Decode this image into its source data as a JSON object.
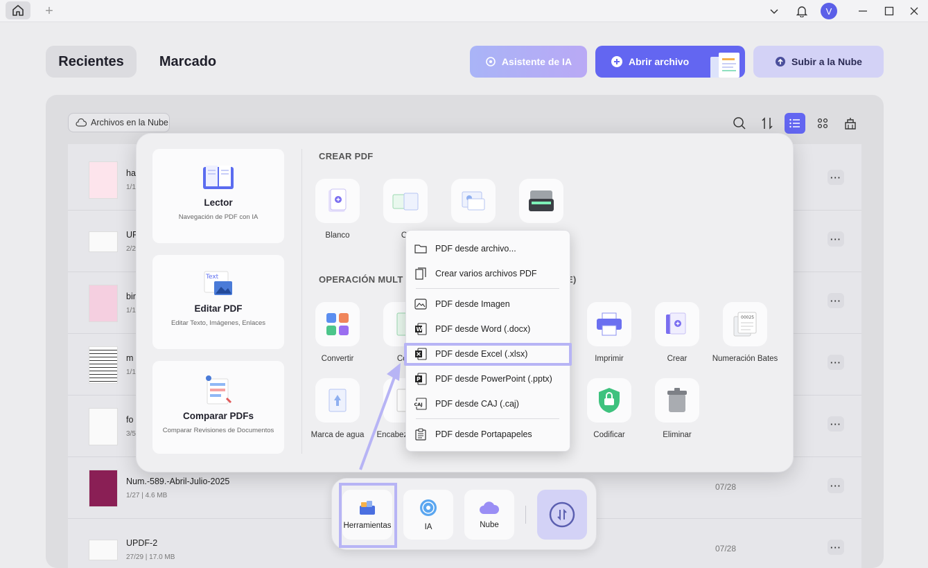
{
  "titlebar": {
    "avatar": "V"
  },
  "tabs": {
    "recientes": "Recientes",
    "marcado": "Marcado"
  },
  "header_buttons": {
    "ai": "Asistente de IA",
    "open": "Abrir archivo",
    "upload": "Subir a la Nube"
  },
  "toolbar": {
    "cloud": "Archivos en la Nube"
  },
  "files": [
    {
      "name": "ha",
      "meta": "1/1"
    },
    {
      "name": "UF",
      "meta": "2/2"
    },
    {
      "name": "bir",
      "meta": "1/1"
    },
    {
      "name": "m",
      "meta": "1/1"
    },
    {
      "name": "fo",
      "meta": "3/5"
    },
    {
      "name": "Num.-589.-Abril-Julio-2025",
      "meta": "1/27 | 4.6 MB",
      "date": "07/28"
    },
    {
      "name": "UPDF-2",
      "meta": "27/29 | 17.0 MB",
      "date": "07/28"
    }
  ],
  "cards": [
    {
      "title": "Lector",
      "sub": "Navegación de PDF con IA"
    },
    {
      "title": "Editar PDF",
      "sub": "Editar Texto, Imágenes, Enlaces"
    },
    {
      "title": "Comparar PDFs",
      "sub": "Comparar Revisiones de Documentos"
    }
  ],
  "crear": {
    "heading": "CREAR PDF",
    "tools": [
      "Blanco",
      "Ot",
      "",
      ""
    ]
  },
  "operacion": {
    "heading": "OPERACIÓN MULT",
    "heading_tail": "E)"
  },
  "ops_row1": [
    "Convertir",
    "Com",
    "",
    "",
    "Imprimir",
    "Crear",
    "Numeración Bates"
  ],
  "ops_row2": [
    "Marca de agua",
    "Encabeza de pá",
    "",
    "",
    "Codificar",
    "Eliminar"
  ],
  "menu": [
    "PDF desde archivo...",
    "Crear varios archivos PDF",
    "PDF desde Imagen",
    "PDF desde Word (.docx)",
    "PDF desde Excel (.xlsx)",
    "PDF desde PowerPoint (.pptx)",
    "PDF desde CAJ (.caj)",
    "PDF desde Portapapeles"
  ],
  "dock": {
    "tools": "Herramientas",
    "ai": "IA",
    "cloud": "Nube"
  },
  "colors": {
    "accent": "#6366f1",
    "highlight": "#b7b4f5"
  }
}
